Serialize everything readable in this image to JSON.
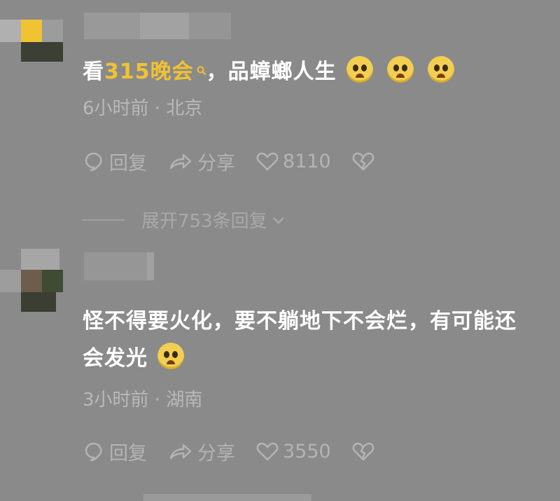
{
  "comments": [
    {
      "text_prefix": "看",
      "text_link": "315晚会",
      "text_suffix": "，品蟑螂人生",
      "meta": "6小时前 · 北京",
      "reply_label": "回复",
      "share_label": "分享",
      "like_count": "8110",
      "expand_label": "展开753条回复"
    },
    {
      "text_line1": "怪不得要火化，要不躺地下不会烂，有可能还",
      "text_line2": "会发光",
      "meta": "3小时前 · 湖南",
      "reply_label": "回复",
      "share_label": "分享",
      "like_count": "3550"
    }
  ],
  "colors": {
    "background": "#8a8a8a",
    "link": "#f1c232",
    "meta": "#b9b9b9"
  },
  "icons": [
    "search-icon",
    "emoji-icon",
    "reply-icon",
    "share-icon",
    "like-icon",
    "dislike-icon",
    "chevron-down-icon"
  ]
}
